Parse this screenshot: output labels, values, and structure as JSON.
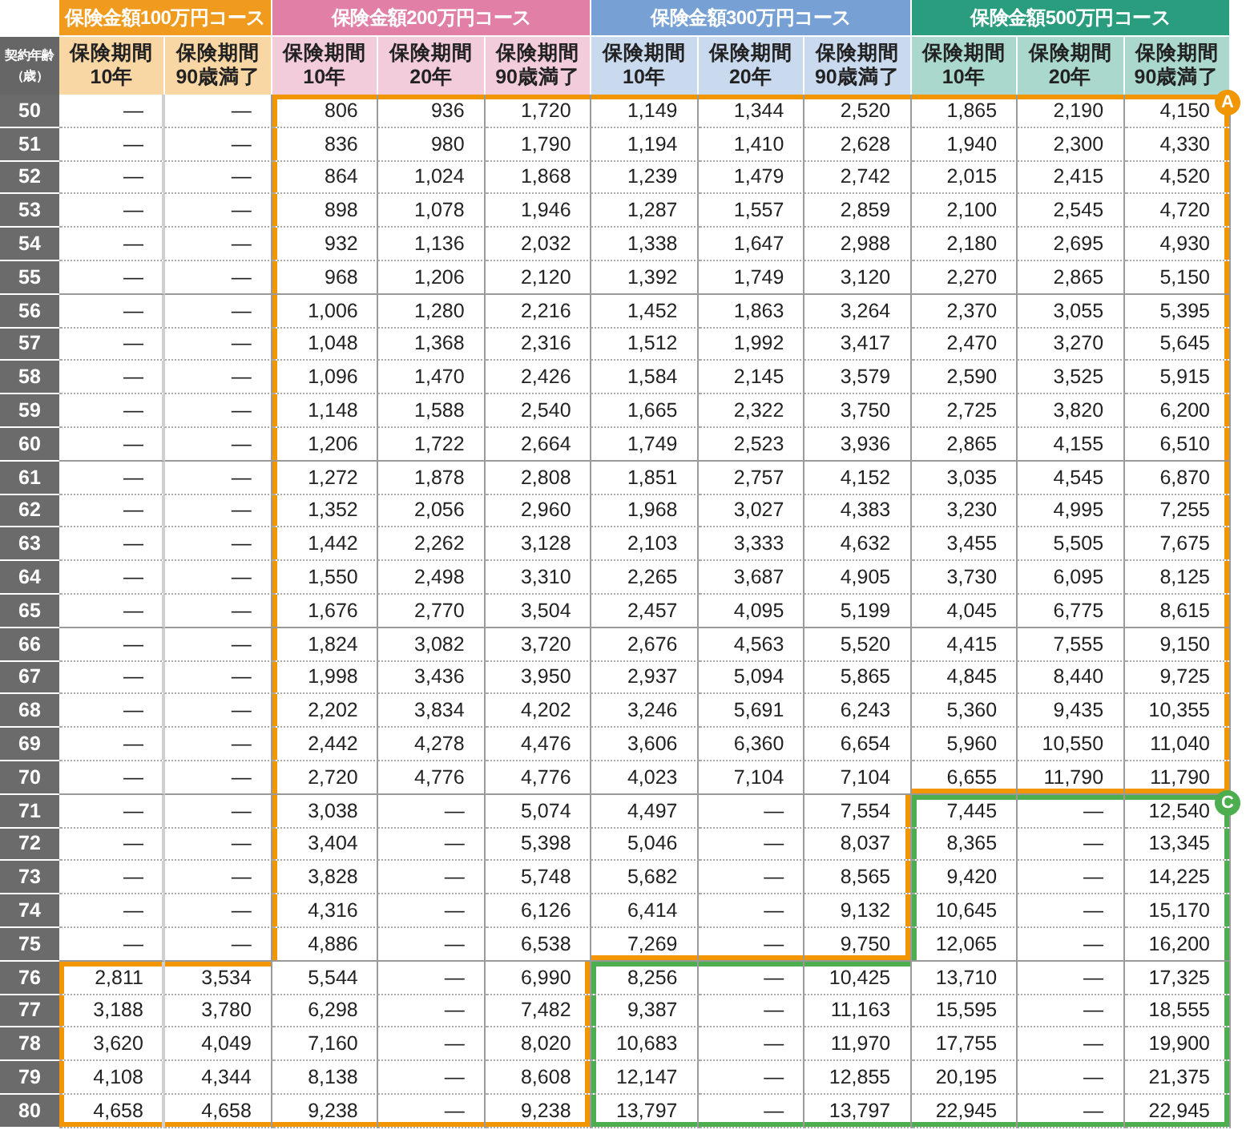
{
  "age_header": "契約年齢（歳）",
  "groups": [
    {
      "label": "保険金額100万円コース",
      "color": "#f09a1e",
      "columns": [
        "保険期間\n10年",
        "保険期間\n90歳満了"
      ]
    },
    {
      "label": "保険金額200万円コース",
      "color": "#e17fa7",
      "columns": [
        "保険期間\n10年",
        "保険期間\n20年",
        "保険期間\n90歳満了"
      ]
    },
    {
      "label": "保険金額300万円コース",
      "color": "#77a1d4",
      "columns": [
        "保険期間\n10年",
        "保険期間\n20年",
        "保険期間\n90歳満了"
      ]
    },
    {
      "label": "保険金額500万円コース",
      "color": "#2b9d7f",
      "columns": [
        "保険期間\n10年",
        "保険期間\n20年",
        "保険期間\n90歳満了"
      ]
    }
  ],
  "rows": [
    {
      "age": "50",
      "kind": "upper",
      "values": [
        "—",
        "—",
        "806",
        "936",
        "1,720",
        "1,149",
        "1,344",
        "2,520",
        "1,865",
        "2,190",
        "4,150"
      ]
    },
    {
      "age": "51",
      "kind": "upper",
      "values": [
        "—",
        "—",
        "836",
        "980",
        "1,790",
        "1,194",
        "1,410",
        "2,628",
        "1,940",
        "2,300",
        "4,330"
      ]
    },
    {
      "age": "52",
      "kind": "upper",
      "values": [
        "—",
        "—",
        "864",
        "1,024",
        "1,868",
        "1,239",
        "1,479",
        "2,742",
        "2,015",
        "2,415",
        "4,520"
      ]
    },
    {
      "age": "53",
      "kind": "upper",
      "values": [
        "—",
        "—",
        "898",
        "1,078",
        "1,946",
        "1,287",
        "1,557",
        "2,859",
        "2,100",
        "2,545",
        "4,720"
      ]
    },
    {
      "age": "54",
      "kind": "upper",
      "values": [
        "—",
        "—",
        "932",
        "1,136",
        "2,032",
        "1,338",
        "1,647",
        "2,988",
        "2,180",
        "2,695",
        "4,930"
      ]
    },
    {
      "age": "55",
      "kind": "upper",
      "values": [
        "—",
        "—",
        "968",
        "1,206",
        "2,120",
        "1,392",
        "1,749",
        "3,120",
        "2,270",
        "2,865",
        "5,150"
      ]
    },
    {
      "age": "56",
      "kind": "upper",
      "values": [
        "—",
        "—",
        "1,006",
        "1,280",
        "2,216",
        "1,452",
        "1,863",
        "3,264",
        "2,370",
        "3,055",
        "5,395"
      ]
    },
    {
      "age": "57",
      "kind": "upper",
      "values": [
        "—",
        "—",
        "1,048",
        "1,368",
        "2,316",
        "1,512",
        "1,992",
        "3,417",
        "2,470",
        "3,270",
        "5,645"
      ]
    },
    {
      "age": "58",
      "kind": "upper",
      "values": [
        "—",
        "—",
        "1,096",
        "1,470",
        "2,426",
        "1,584",
        "2,145",
        "3,579",
        "2,590",
        "3,525",
        "5,915"
      ]
    },
    {
      "age": "59",
      "kind": "upper",
      "values": [
        "—",
        "—",
        "1,148",
        "1,588",
        "2,540",
        "1,665",
        "2,322",
        "3,750",
        "2,725",
        "3,820",
        "6,200"
      ]
    },
    {
      "age": "60",
      "kind": "upper",
      "values": [
        "—",
        "—",
        "1,206",
        "1,722",
        "2,664",
        "1,749",
        "2,523",
        "3,936",
        "2,865",
        "4,155",
        "6,510"
      ]
    },
    {
      "age": "61",
      "kind": "upper",
      "values": [
        "—",
        "—",
        "1,272",
        "1,878",
        "2,808",
        "1,851",
        "2,757",
        "4,152",
        "3,035",
        "4,545",
        "6,870"
      ]
    },
    {
      "age": "62",
      "kind": "upper",
      "values": [
        "—",
        "—",
        "1,352",
        "2,056",
        "2,960",
        "1,968",
        "3,027",
        "4,383",
        "3,230",
        "4,995",
        "7,255"
      ]
    },
    {
      "age": "63",
      "kind": "upper",
      "values": [
        "—",
        "—",
        "1,442",
        "2,262",
        "3,128",
        "2,103",
        "3,333",
        "4,632",
        "3,455",
        "5,505",
        "7,675"
      ]
    },
    {
      "age": "64",
      "kind": "upper",
      "values": [
        "—",
        "—",
        "1,550",
        "2,498",
        "3,310",
        "2,265",
        "3,687",
        "4,905",
        "3,730",
        "6,095",
        "8,125"
      ]
    },
    {
      "age": "65",
      "kind": "upper",
      "values": [
        "—",
        "—",
        "1,676",
        "2,770",
        "3,504",
        "2,457",
        "4,095",
        "5,199",
        "4,045",
        "6,775",
        "8,615"
      ]
    },
    {
      "age": "66",
      "kind": "upper",
      "values": [
        "—",
        "—",
        "1,824",
        "3,082",
        "3,720",
        "2,676",
        "4,563",
        "5,520",
        "4,415",
        "7,555",
        "9,150"
      ]
    },
    {
      "age": "67",
      "kind": "upper",
      "values": [
        "—",
        "—",
        "1,998",
        "3,436",
        "3,950",
        "2,937",
        "5,094",
        "5,865",
        "4,845",
        "8,440",
        "9,725"
      ]
    },
    {
      "age": "68",
      "kind": "upper",
      "values": [
        "—",
        "—",
        "2,202",
        "3,834",
        "4,202",
        "3,246",
        "5,691",
        "6,243",
        "5,360",
        "9,435",
        "10,355"
      ]
    },
    {
      "age": "69",
      "kind": "upper",
      "values": [
        "—",
        "—",
        "2,442",
        "4,278",
        "4,476",
        "3,606",
        "6,360",
        "6,654",
        "5,960",
        "10,550",
        "11,040"
      ]
    },
    {
      "age": "70",
      "kind": "upper",
      "values": [
        "—",
        "—",
        "2,720",
        "4,776",
        "4,776",
        "4,023",
        "7,104",
        "7,104",
        "6,655",
        "11,790",
        "11,790"
      ]
    },
    {
      "age": "71",
      "kind": "middle",
      "values": [
        "—",
        "—",
        "3,038",
        "—",
        "5,074",
        "4,497",
        "—",
        "7,554",
        "7,445",
        "—",
        "12,540"
      ]
    },
    {
      "age": "72",
      "kind": "middle",
      "values": [
        "—",
        "—",
        "3,404",
        "—",
        "5,398",
        "5,046",
        "—",
        "8,037",
        "8,365",
        "—",
        "13,345"
      ]
    },
    {
      "age": "73",
      "kind": "middle",
      "values": [
        "—",
        "—",
        "3,828",
        "—",
        "5,748",
        "5,682",
        "—",
        "8,565",
        "9,420",
        "—",
        "14,225"
      ]
    },
    {
      "age": "74",
      "kind": "middle",
      "values": [
        "—",
        "—",
        "4,316",
        "—",
        "6,126",
        "6,414",
        "—",
        "9,132",
        "10,645",
        "—",
        "15,170"
      ]
    },
    {
      "age": "75",
      "kind": "middle",
      "values": [
        "—",
        "—",
        "4,886",
        "—",
        "6,538",
        "7,269",
        "—",
        "9,750",
        "12,065",
        "—",
        "16,200"
      ]
    },
    {
      "age": "76",
      "kind": "lower",
      "values": [
        "2,811",
        "3,534",
        "5,544",
        "—",
        "6,990",
        "8,256",
        "—",
        "10,425",
        "13,710",
        "—",
        "17,325"
      ]
    },
    {
      "age": "77",
      "kind": "lower",
      "values": [
        "3,188",
        "3,780",
        "6,298",
        "—",
        "7,482",
        "9,387",
        "—",
        "11,163",
        "15,595",
        "—",
        "18,555"
      ]
    },
    {
      "age": "78",
      "kind": "lower",
      "values": [
        "3,620",
        "4,049",
        "7,160",
        "—",
        "8,020",
        "10,683",
        "—",
        "11,970",
        "17,755",
        "—",
        "19,900"
      ]
    },
    {
      "age": "79",
      "kind": "lower",
      "values": [
        "4,108",
        "4,344",
        "8,138",
        "—",
        "8,608",
        "12,147",
        "—",
        "12,855",
        "20,195",
        "—",
        "21,375"
      ]
    },
    {
      "age": "80",
      "kind": "lower",
      "values": [
        "4,658",
        "4,658",
        "9,238",
        "—",
        "9,238",
        "13,797",
        "—",
        "13,797",
        "22,945",
        "—",
        "22,945"
      ]
    }
  ],
  "highlights": [
    {
      "badge": "A",
      "color": "#f29600"
    },
    {
      "badge": "C",
      "color": "#4cae4f"
    }
  ]
}
